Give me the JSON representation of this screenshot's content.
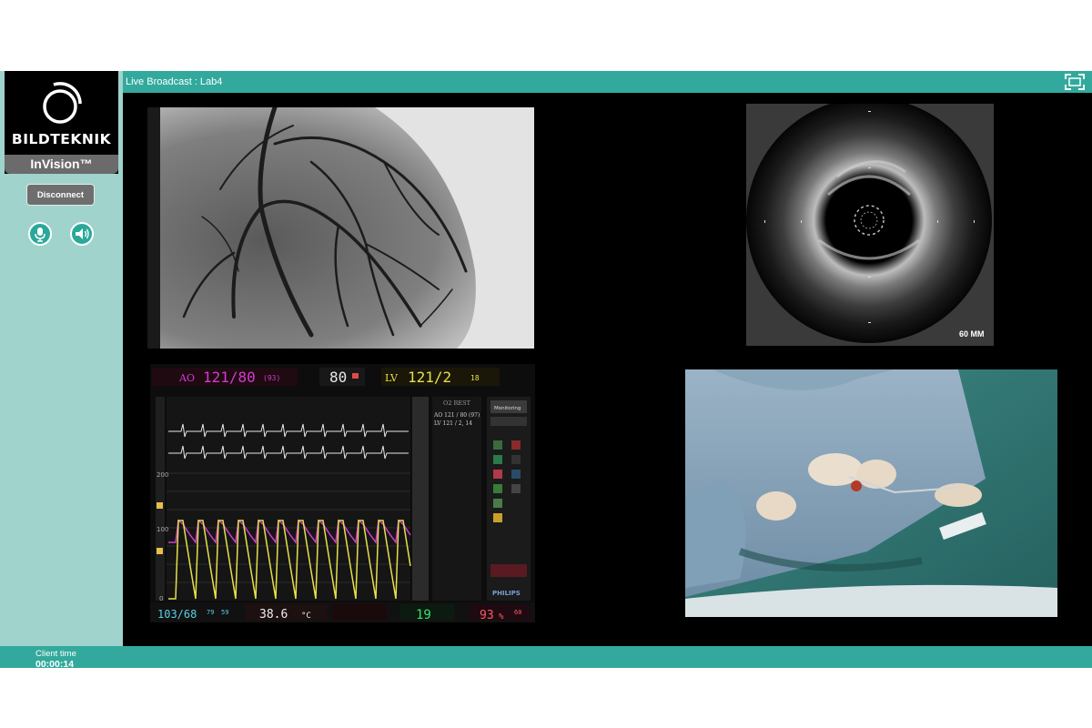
{
  "sidebar": {
    "logo_text": "BILDTEKNIK",
    "product_name": "InVision™",
    "disconnect_label": "Disconnect",
    "mic_icon": "microphone-icon",
    "speaker_icon": "speaker-icon"
  },
  "header": {
    "title": "Live Broadcast : Lab4",
    "fullscreen_icon": "fullscreen-icon"
  },
  "footer": {
    "client_time_label": "Client  time",
    "client_time_value": "00:00:14"
  },
  "ivus": {
    "depth_label": "60 MM"
  },
  "monitor": {
    "ao_label": "AO",
    "ao_value": "121/80",
    "ao_mean": "(93)",
    "hr_value": "80",
    "lv_label": "LV",
    "lv_value": "121/2",
    "lv_extra": "18",
    "scale_200": "200",
    "scale_100": "100",
    "scale_0": "0",
    "side_header": "O2 REST",
    "side_line1": "AO 121 / 80 (97)",
    "side_line2": "LV 121 / 2, 14",
    "btn_monitoring": "Monitoring",
    "brand": "PHILIPS",
    "bottom_bp": "103/68",
    "bottom_small1": "79",
    "bottom_small2": "59",
    "temp_value": "38.6",
    "temp_unit": "°C",
    "resp_value": "19",
    "spo2_value": "93",
    "spo2_unit": "%",
    "spo2_small": "60"
  },
  "colors": {
    "teal_bar": "#33a99d",
    "sidebar_bg": "#9fd3cc",
    "ao_magenta": "#d23bd2",
    "lv_yellow": "#e5e04a",
    "resp_green": "#3be36a",
    "spo2_red": "#ff5a6a"
  }
}
